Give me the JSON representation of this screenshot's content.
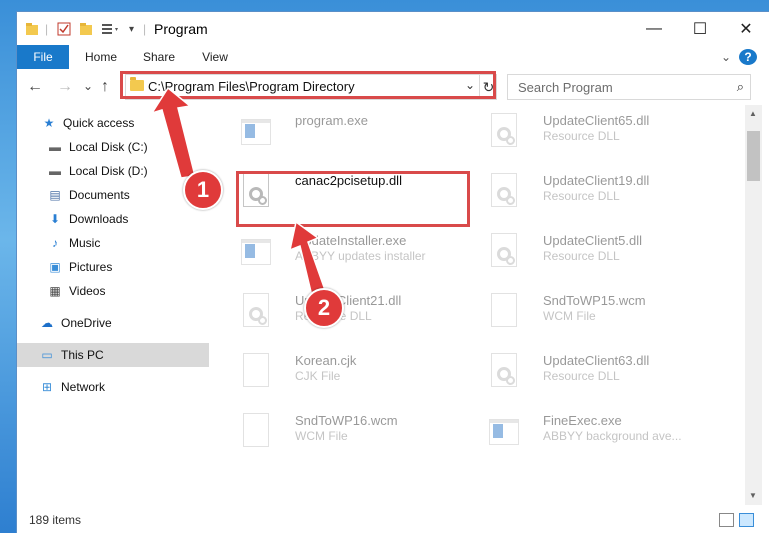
{
  "window": {
    "title": "Program",
    "controls": {
      "minimize": "—",
      "maximize": "☐",
      "close": "✕"
    }
  },
  "ribbon": {
    "tabs": [
      "File",
      "Home",
      "Share",
      "View"
    ],
    "expand": "⌄",
    "help": "?"
  },
  "nav": {
    "back": "←",
    "forward": "→",
    "recent": "⌄",
    "up": "↑",
    "address": "C:\\Program Files\\Program Directory",
    "address_dropdown": "⌄",
    "refresh": "↻",
    "search_placeholder": "Search Program",
    "search_icon": "⌕"
  },
  "sidebar": {
    "items": [
      {
        "label": "Quick access",
        "icon": "star-icon",
        "glyph": "★",
        "color": "#2a7fd3"
      },
      {
        "label": "Local Disk (C:)",
        "icon": "drive-icon",
        "glyph": "▬",
        "color": "#666666",
        "pinned": true
      },
      {
        "label": "Local Disk (D:)",
        "icon": "drive-icon",
        "glyph": "▬",
        "color": "#666666"
      },
      {
        "label": "Documents",
        "icon": "documents-icon",
        "glyph": "▤",
        "color": "#4a6fa5"
      },
      {
        "label": "Downloads",
        "icon": "downloads-icon",
        "glyph": "⬇",
        "color": "#2a7fd3",
        "pinned": true
      },
      {
        "label": "Music",
        "icon": "music-icon",
        "glyph": "♪",
        "color": "#2a7fd3",
        "pinned": true
      },
      {
        "label": "Pictures",
        "icon": "pictures-icon",
        "glyph": "▣",
        "color": "#3a8ed8",
        "pinned": true
      },
      {
        "label": "Videos",
        "icon": "videos-icon",
        "glyph": "▦",
        "color": "#444444",
        "pinned": true
      },
      {
        "label": "OneDrive",
        "icon": "onedrive-icon",
        "glyph": "☁",
        "color": "#1c6fc9"
      },
      {
        "label": "This PC",
        "icon": "this-pc-icon",
        "glyph": "▭",
        "color": "#3a8ed8",
        "selected": true
      },
      {
        "label": "Network",
        "icon": "network-icon",
        "glyph": "⊞",
        "color": "#3a8ed8"
      }
    ],
    "pin_glyph": "✱"
  },
  "files": [
    {
      "name": "program.exe",
      "type": "",
      "kind": "exe",
      "faded": true
    },
    {
      "name": "UpdateClient65.dll",
      "type": "Resource DLL",
      "kind": "dll",
      "faded": true
    },
    {
      "name": "canac2pcisetup.dll",
      "type": "",
      "kind": "dll",
      "faded": false
    },
    {
      "name": "UpdateClient19.dll",
      "type": "Resource DLL",
      "kind": "dll",
      "faded": true
    },
    {
      "name": "UpdateInstaller.exe",
      "type": "ABBYY updates installer",
      "kind": "exe",
      "faded": true
    },
    {
      "name": "UpdateClient5.dll",
      "type": "Resource DLL",
      "kind": "dll",
      "faded": true
    },
    {
      "name": "UpdateClient21.dll",
      "type": "Resource DLL",
      "kind": "dll",
      "faded": true
    },
    {
      "name": "SndToWP15.wcm",
      "type": "WCM File",
      "kind": "doc",
      "faded": true
    },
    {
      "name": "Korean.cjk",
      "type": "CJK File",
      "kind": "doc",
      "faded": true
    },
    {
      "name": "UpdateClient63.dll",
      "type": "Resource DLL",
      "kind": "dll",
      "faded": true
    },
    {
      "name": "SndToWP16.wcm",
      "type": "WCM File",
      "kind": "doc",
      "faded": true
    },
    {
      "name": "FineExec.exe",
      "type": "ABBYY background ave...",
      "kind": "exe",
      "faded": true
    }
  ],
  "status": {
    "count": "189 items"
  },
  "annotations": {
    "step1": "1",
    "step2": "2"
  },
  "colors": {
    "accent": "#1979ca",
    "highlight": "#d94a4a",
    "marker": "#e03a3a"
  }
}
